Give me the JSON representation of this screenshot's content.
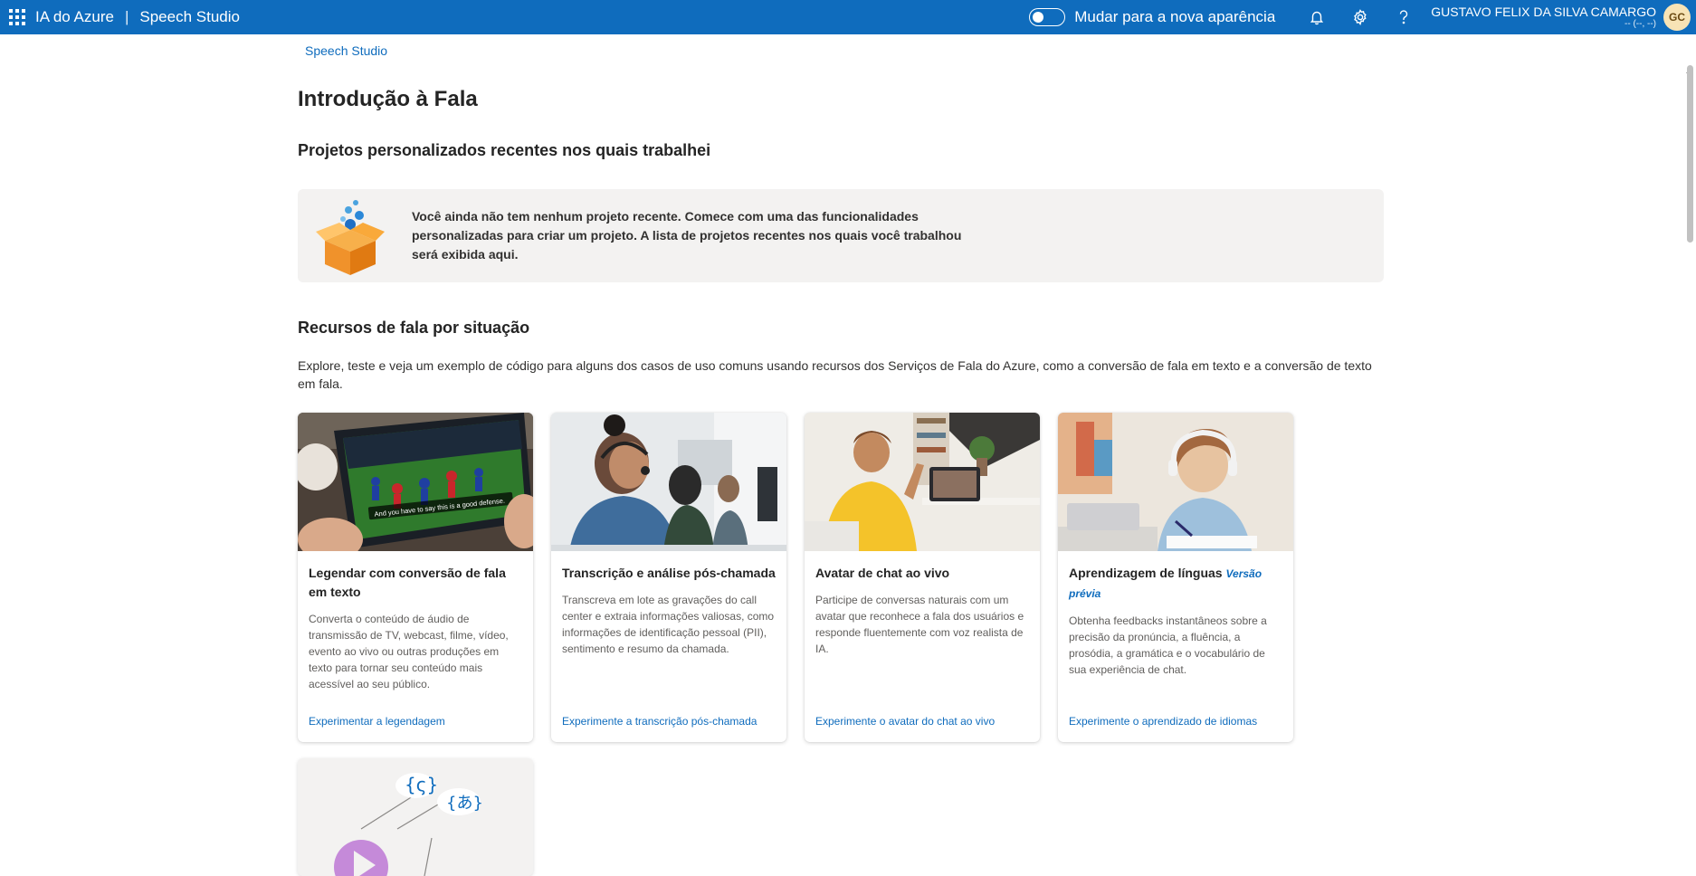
{
  "header": {
    "app_name": "IA do Azure",
    "separator": "|",
    "product": "Speech Studio",
    "toggle_label": "Mudar para a nova aparência",
    "toggle_on": false,
    "user_name": "GUSTAVO FELIX DA SILVA CAMARGO",
    "user_sub": "-- (--, --)",
    "avatar_initials": "GC",
    "icons": [
      "waffle-icon",
      "bell-icon",
      "gear-icon",
      "help-icon"
    ]
  },
  "breadcrumb": "Speech Studio",
  "page_title": "Introdução à Fala",
  "recent": {
    "title": "Projetos personalizados recentes nos quais trabalhei",
    "empty_text": "Você ainda não tem nenhum projeto recente. Comece com uma das funcionalidades personalizadas para criar um projeto. A lista de projetos recentes nos quais você trabalhou será exibida aqui."
  },
  "scenarios": {
    "title": "Recursos de fala por situação",
    "intro": "Explore, teste e veja um exemplo de código para alguns dos casos de uso comuns usando recursos dos Serviços de Fala do Azure, como a conversão de fala em texto e a conversão de texto em fala.",
    "cards": [
      {
        "title": "Legendar com conversão de fala em texto",
        "preview": "",
        "description": "Converta o conteúdo de áudio de transmissão de TV, webcast, filme, vídeo, evento ao vivo ou outras produções em texto para tornar seu conteúdo mais acessível ao seu público.",
        "link": "Experimentar a legendagem",
        "image_caption": "And you have to say this is a good defense."
      },
      {
        "title": "Transcrição e análise pós-chamada",
        "preview": "",
        "description": "Transcreva em lote as gravações do call center e extraia informações valiosas, como informações de identificação pessoal (PII), sentimento e resumo da chamada.",
        "link": "Experimente a transcrição pós-chamada"
      },
      {
        "title": "Avatar de chat ao vivo",
        "preview": "",
        "description": "Participe de conversas naturais com um avatar que reconhece a fala dos usuários e responde fluentemente com voz realista de IA.",
        "link": "Experimente o avatar do chat ao vivo"
      },
      {
        "title": "Aprendizagem de línguas",
        "preview": "Versão prévia",
        "description": "Obtenha feedbacks instantâneos sobre a precisão da pronúncia, a fluência, a prosódia, a gramática e o vocabulário de sua experiência de chat.",
        "link": "Experimente o aprendizado de idiomas"
      }
    ]
  },
  "colors": {
    "header_bg": "#0f6cbd",
    "link": "#0f6cbd",
    "empty_bg": "#f3f2f1"
  }
}
